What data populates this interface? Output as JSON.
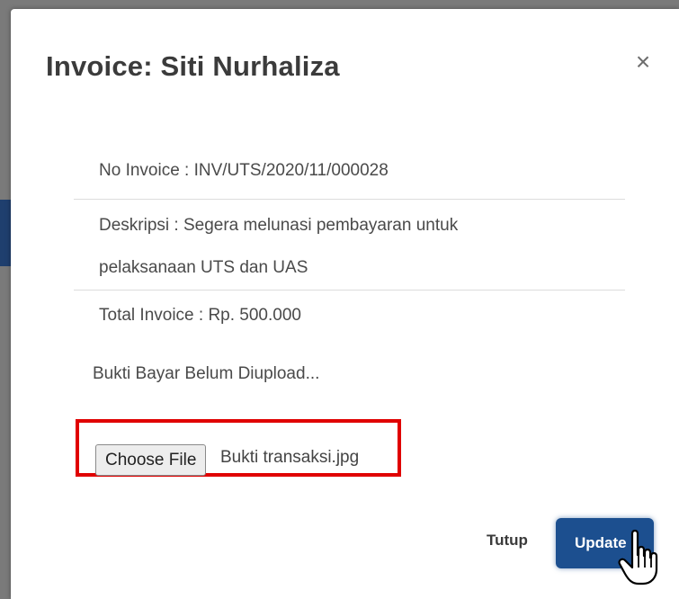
{
  "modal": {
    "title": "Invoice: Siti Nurhaliza",
    "close_icon": "close-icon",
    "close_symbol": "×"
  },
  "invoice": {
    "number_line": "No Invoice : INV/UTS/2020/11/000028",
    "description_line": "Deskripsi : Segera melunasi pembayaran untuk pelaksanaan UTS dan UAS",
    "total_line": "Total Invoice : Rp. 500.000"
  },
  "upload": {
    "status": "Bukti Bayar Belum Diupload...",
    "choose_file_label": "Choose File",
    "selected_file": "Bukti transaksi.jpg",
    "highlight_color": "#e00000"
  },
  "footer": {
    "close_label": "Tutup",
    "update_label": "Update"
  },
  "colors": {
    "primary": "#1c4f8f",
    "title": "#3b3b3b",
    "text": "#4a4a4a"
  },
  "cursor_icon": "hand-pointer-icon"
}
